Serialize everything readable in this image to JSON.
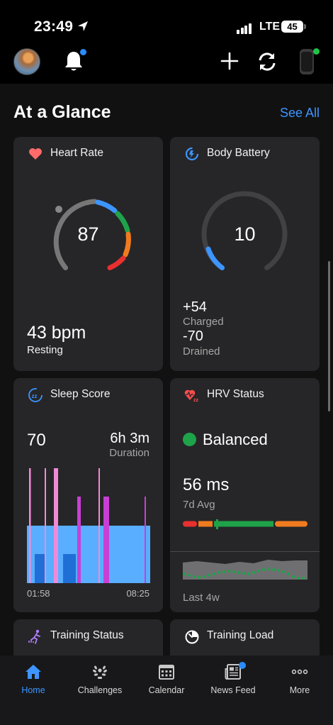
{
  "status_bar": {
    "time": "23:49",
    "network": "LTE",
    "battery": "45"
  },
  "section": {
    "title": "At a Glance",
    "see_all": "See All"
  },
  "heart_rate": {
    "title": "Heart Rate",
    "value": "87",
    "resting_value": "43 bpm",
    "resting_label": "Resting",
    "icon": "heart-icon",
    "color": "#ff6b6b"
  },
  "body_battery": {
    "title": "Body Battery",
    "value": "10",
    "charged_value": "+54",
    "charged_label": "Charged",
    "drained_value": "-70",
    "drained_label": "Drained",
    "level": 0.1,
    "icon": "body-battery-icon"
  },
  "sleep_score": {
    "title": "Sleep Score",
    "score": "70",
    "duration": "6h 3m",
    "duration_label": "Duration",
    "start_time": "01:58",
    "end_time": "08:25",
    "icon": "sleep-icon",
    "stage_colors": {
      "light": "#5aaeff",
      "deep": "#1f6fd6",
      "rem": "#c93fd6",
      "awake": "#f08ad8"
    }
  },
  "hrv_status": {
    "title": "HRV Status",
    "status": "Balanced",
    "status_color": "#1fa34a",
    "value": "56 ms",
    "value_label": "7d Avg",
    "trend_label": "Last 4w",
    "icon": "hrv-icon"
  },
  "training_status": {
    "title": "Training Status",
    "icon": "training-status-icon"
  },
  "training_load": {
    "title": "Training Load",
    "icon": "training-load-icon"
  },
  "tabs": [
    {
      "label": "Home",
      "icon": "home-icon",
      "active": true
    },
    {
      "label": "Challenges",
      "icon": "laurel-icon",
      "active": false
    },
    {
      "label": "Calendar",
      "icon": "calendar-icon",
      "active": false
    },
    {
      "label": "News Feed",
      "icon": "news-feed-icon",
      "active": false
    },
    {
      "label": "More",
      "icon": "more-icon",
      "active": false
    }
  ],
  "colors": {
    "accent": "#3d95ff",
    "card": "#262628",
    "background": "#111112"
  }
}
